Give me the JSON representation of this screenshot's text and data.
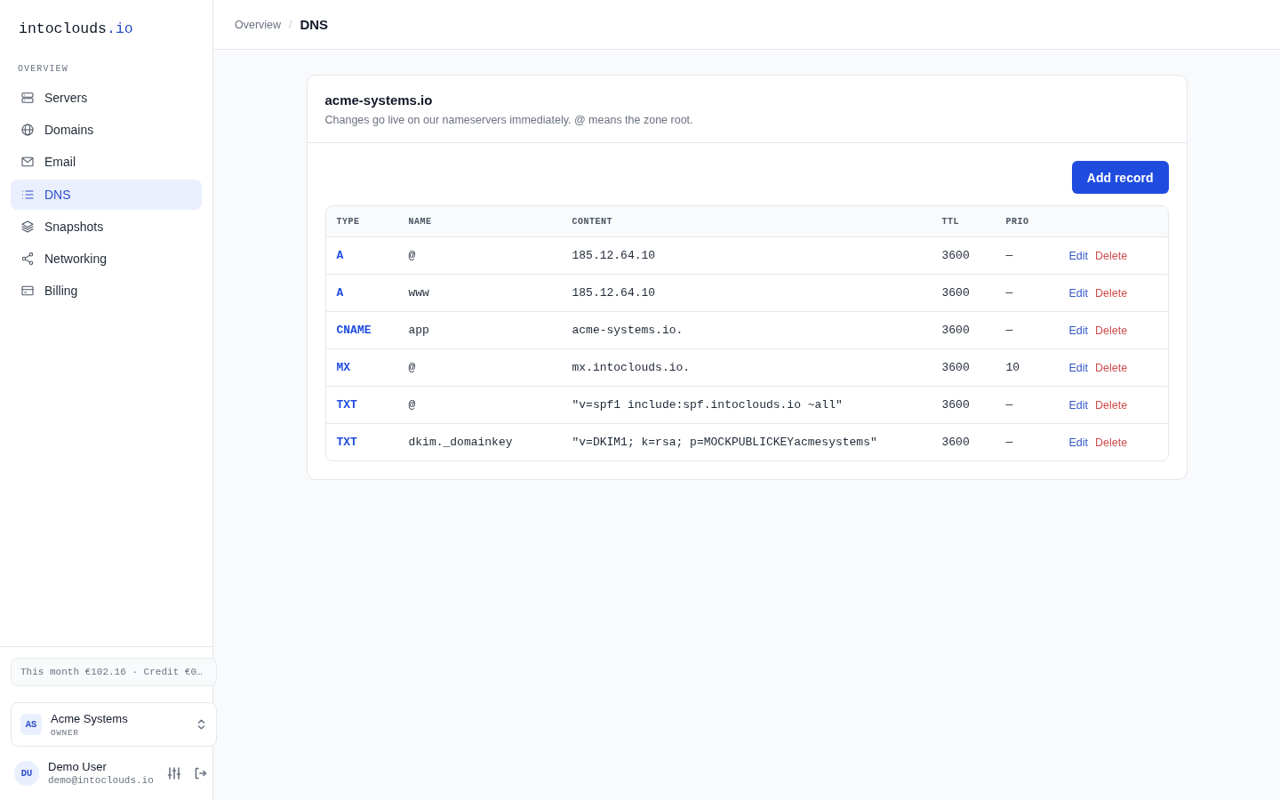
{
  "sidebar": {
    "logo": {
      "name": "intoclouds",
      "suffix": ".io"
    },
    "section_label": "OVERVIEW",
    "items": [
      {
        "label": "Servers",
        "selected": false
      },
      {
        "label": "Domains",
        "selected": false
      },
      {
        "label": "Email",
        "selected": false
      },
      {
        "label": "DNS",
        "selected": true
      },
      {
        "label": "Snapshots",
        "selected": false
      },
      {
        "label": "Networking",
        "selected": false
      },
      {
        "label": "Billing",
        "selected": false
      }
    ],
    "billing_summary": "This month €102.16 · Credit €0…",
    "organization": {
      "initials": "AS",
      "name": "Acme Systems",
      "role": "OWNER"
    },
    "user": {
      "initials": "DU",
      "name": "Demo User",
      "email": "demo@intoclouds.io"
    }
  },
  "header": {
    "breadcrumb": [
      {
        "label": "Overview",
        "current": false
      },
      {
        "label": "DNS",
        "current": true
      }
    ],
    "separator": "/"
  },
  "card": {
    "title": "acme-systems.io",
    "subtitle": "Changes go live on our nameservers immediately. @ means the zone root.",
    "add_button": "Add record",
    "table": {
      "columns": [
        "TYPE",
        "NAME",
        "CONTENT",
        "TTL",
        "PRIO"
      ],
      "rows": [
        {
          "type": "A",
          "name": "@",
          "content": "185.12.64.10",
          "ttl": "3600",
          "prio": "—",
          "actions": [
            {
              "label": "Edit",
              "kind": "edit"
            },
            {
              "label": "Delete",
              "kind": "delete"
            }
          ]
        },
        {
          "type": "A",
          "name": "www",
          "content": "185.12.64.10",
          "ttl": "3600",
          "prio": "—",
          "actions": [
            {
              "label": "Edit",
              "kind": "edit"
            },
            {
              "label": "Delete",
              "kind": "delete"
            }
          ]
        },
        {
          "type": "CNAME",
          "name": "app",
          "content": "acme-systems.io.",
          "ttl": "3600",
          "prio": "—",
          "actions": [
            {
              "label": "Edit",
              "kind": "edit"
            },
            {
              "label": "Delete",
              "kind": "delete"
            }
          ]
        },
        {
          "type": "MX",
          "name": "@",
          "content": "mx.intoclouds.io.",
          "ttl": "3600",
          "prio": "10",
          "actions": [
            {
              "label": "Edit",
              "kind": "edit"
            },
            {
              "label": "Delete",
              "kind": "delete"
            }
          ]
        },
        {
          "type": "TXT",
          "name": "@",
          "content": "\"v=spf1 include:spf.intoclouds.io ~all\"",
          "ttl": "3600",
          "prio": "—",
          "actions": [
            {
              "label": "Edit",
              "kind": "edit"
            },
            {
              "label": "Delete",
              "kind": "delete"
            }
          ]
        },
        {
          "type": "TXT",
          "name": "dkim._domainkey",
          "content": "\"v=DKIM1; k=rsa; p=MOCKPUBLICKEYacmesystems\"",
          "ttl": "3600",
          "prio": "—",
          "actions": [
            {
              "label": "Edit",
              "kind": "edit"
            },
            {
              "label": "Delete",
              "kind": "delete"
            }
          ]
        }
      ]
    }
  }
}
